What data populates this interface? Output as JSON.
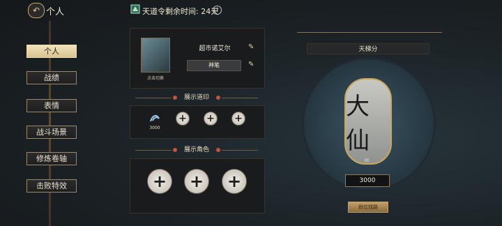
{
  "header": {
    "back_icon": "back-arrow-icon",
    "title": "个人",
    "timer_label": "天道令剩余时间:",
    "timer_value": "24天",
    "help_icon": "?"
  },
  "nav": {
    "items": [
      "个人",
      "战绩",
      "表情",
      "战斗场景",
      "修炼卷轴",
      "击败特效"
    ],
    "active_index": 0
  },
  "profile": {
    "avatar_caption": "点击切换",
    "name": "超市诺艾尔",
    "title_tag": "神笔",
    "edit_icon": "pencil-icon"
  },
  "sections": {
    "seal_title": "展示道印",
    "role_title": "展示角色"
  },
  "seal": {
    "value": "3000"
  },
  "rank": {
    "title": "天梯分",
    "emblem_text": "大仙",
    "emblem_sub": "III",
    "score": "3000",
    "button_label": "段位找路"
  },
  "colors": {
    "accent_gold": "#c9a86a",
    "active_nav_bg": "#e7d3a0"
  }
}
